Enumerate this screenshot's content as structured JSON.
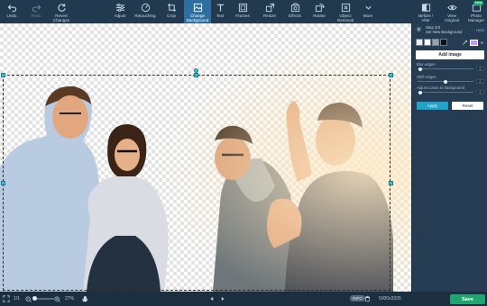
{
  "toolbar": {
    "undo": "Undo",
    "redo": "Redo",
    "revert": "Revert\nChanges",
    "adjust": "Adjust",
    "retouching": "Retouching",
    "crop": "Crop",
    "change_background": "Change\nBackground",
    "text": "Text",
    "frames": "Frames",
    "resize": "Resize",
    "effects": "Effects",
    "rotate": "Rotate",
    "object_removal": "Object\nRemoval",
    "more": "More",
    "before_after": "Before /\nAfter",
    "view_original": "View\nOriginal",
    "photo_manager": "Photo\nManager",
    "new_badge": "New"
  },
  "panel": {
    "step": "Step 3/3",
    "subtitle": "Set New Background",
    "help": "Help",
    "add_image": "Add image",
    "sliders": [
      {
        "label": "Blur edges",
        "value": "0",
        "level": 0.05
      },
      {
        "label": "Shift edges",
        "value": "0",
        "level": 0.5
      },
      {
        "label": "Adjust colors to background",
        "value": "0",
        "level": 0.05
      }
    ],
    "apply": "Apply",
    "reset": "Reset",
    "picker_color": "#c697ff"
  },
  "status": {
    "page": "1/1",
    "zoom": "27%",
    "dimensions": "5000x3335",
    "info_badge": "INFO",
    "save": "Save"
  },
  "colors": {
    "toolbar": "#213a50",
    "active_tool": "#2d6fa3",
    "save": "#1fa56e",
    "apply": "#20a3c9",
    "selection_handle": "#39c0d3"
  },
  "icons": [
    "undo-icon",
    "redo-icon",
    "revert-icon",
    "adjust-icon",
    "retouching-icon",
    "crop-icon",
    "change-background-icon",
    "text-icon",
    "frames-icon",
    "resize-icon",
    "effects-icon",
    "rotate-icon",
    "object-removal-icon",
    "chevron-down-icon",
    "before-after-icon",
    "eye-icon",
    "photo-manager-icon",
    "fit-screen-icon",
    "zoom-out-icon",
    "zoom-in-icon",
    "hand-icon",
    "prev-icon",
    "next-icon",
    "trash-icon",
    "back-icon",
    "eyedropper-icon"
  ]
}
